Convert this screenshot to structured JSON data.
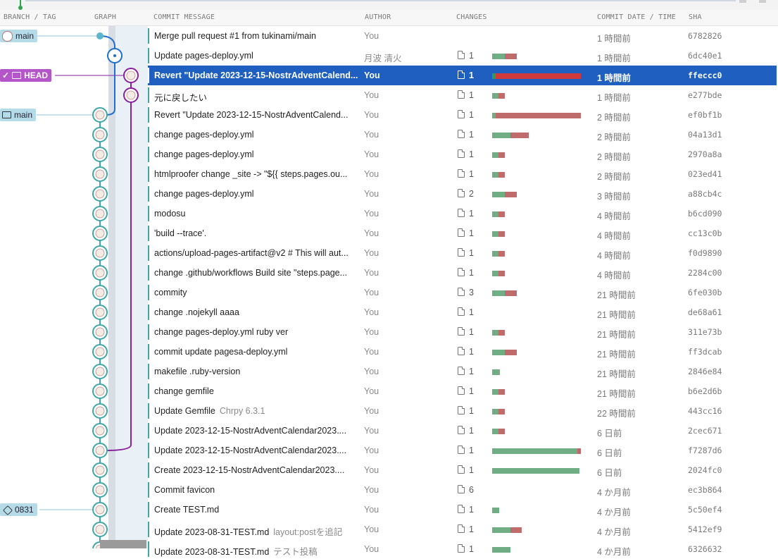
{
  "columns": {
    "branch_tag": "BRANCH / TAG",
    "graph": "GRAPH",
    "commit_message": "COMMIT MESSAGE",
    "author": "AUTHOR",
    "changes": "CHANGES",
    "commit_date": "COMMIT DATE / TIME",
    "sha": "SHA"
  },
  "labels": {
    "main_remote": "main",
    "head": "HEAD",
    "main_local": "main",
    "tag_0831": "0831"
  },
  "colors": {
    "selected_row": "#1f5fbf",
    "head_label": "#b455c9",
    "branch_label": "#b6dbe8",
    "lane_blue": "#1e6fd0",
    "lane_purple": "#8a1fa0",
    "lane_teal": "#3fa7a7",
    "additions": "#6fae85",
    "deletions": "#c06b6b"
  },
  "commits": [
    {
      "message": "Merge pull request #1 from tukinami/main",
      "tag": "",
      "author": "You",
      "changes": "",
      "add": 0,
      "del": 0,
      "date": "1 時間前",
      "sha": "6782826",
      "selected": false
    },
    {
      "message": "Update pages-deploy.yml",
      "tag": "",
      "author": "月波 清火",
      "changes": "1",
      "add": 18,
      "del": 17,
      "date": "1 時間前",
      "sha": "6dc40e1",
      "selected": false
    },
    {
      "message": "Revert \"Update 2023-12-15-NostrAdventCalend...",
      "tag": "",
      "author": "You",
      "changes": "1",
      "add": 5,
      "del": 121,
      "date": "1 時間前",
      "sha": "ffeccc0",
      "selected": true
    },
    {
      "message": "元に戻したい",
      "tag": "",
      "author": "You",
      "changes": "1",
      "add": 9,
      "del": 9,
      "date": "1 時間前",
      "sha": "e277bde",
      "selected": false
    },
    {
      "message": "Revert \"Update 2023-12-15-NostrAdventCalend...",
      "tag": "",
      "author": "You",
      "changes": "1",
      "add": 5,
      "del": 121,
      "date": "2 時間前",
      "sha": "ef0bf1b",
      "selected": false
    },
    {
      "message": "change pages-deploy.yml",
      "tag": "",
      "author": "You",
      "changes": "1",
      "add": 26,
      "del": 26,
      "date": "2 時間前",
      "sha": "04a13d1",
      "selected": false
    },
    {
      "message": "change pages-deploy.yml",
      "tag": "",
      "author": "You",
      "changes": "1",
      "add": 9,
      "del": 9,
      "date": "2 時間前",
      "sha": "2970a8a",
      "selected": false
    },
    {
      "message": "htmlproofer change _site -> \"${{ steps.pages.ou...",
      "tag": "",
      "author": "You",
      "changes": "1",
      "add": 9,
      "del": 9,
      "date": "2 時間前",
      "sha": "023ed41",
      "selected": false
    },
    {
      "message": "change pages-deploy.yml",
      "tag": "",
      "author": "You",
      "changes": "2",
      "add": 18,
      "del": 17,
      "date": "3 時間前",
      "sha": "a88cb4c",
      "selected": false
    },
    {
      "message": "modosu",
      "tag": "",
      "author": "You",
      "changes": "1",
      "add": 9,
      "del": 9,
      "date": "4 時間前",
      "sha": "b6cd090",
      "selected": false
    },
    {
      "message": "'build --trace'.",
      "tag": "",
      "author": "You",
      "changes": "1",
      "add": 9,
      "del": 9,
      "date": "4 時間前",
      "sha": "cc13c0b",
      "selected": false
    },
    {
      "message": "actions/upload-pages-artifact@v2 # This will aut...",
      "tag": "",
      "author": "You",
      "changes": "1",
      "add": 9,
      "del": 9,
      "date": "4 時間前",
      "sha": "f0d9890",
      "selected": false
    },
    {
      "message": "change .github/workflows Build site \"steps.page...",
      "tag": "",
      "author": "You",
      "changes": "1",
      "add": 9,
      "del": 9,
      "date": "4 時間前",
      "sha": "2284c00",
      "selected": false
    },
    {
      "message": "commity",
      "tag": "",
      "author": "You",
      "changes": "3",
      "add": 18,
      "del": 17,
      "date": "21 時間前",
      "sha": "6fe030b",
      "selected": false
    },
    {
      "message": "change .nojekyll aaaa",
      "tag": "",
      "author": "You",
      "changes": "1",
      "add": 0,
      "del": 0,
      "date": "21 時間前",
      "sha": "de68a61",
      "selected": false
    },
    {
      "message": "change pages-deploy.yml ruby ver",
      "tag": "",
      "author": "You",
      "changes": "1",
      "add": 9,
      "del": 9,
      "date": "21 時間前",
      "sha": "311e73b",
      "selected": false
    },
    {
      "message": "commit update pagesa-deploy.yml",
      "tag": "",
      "author": "You",
      "changes": "1",
      "add": 18,
      "del": 17,
      "date": "21 時間前",
      "sha": "ff3dcab",
      "selected": false
    },
    {
      "message": "makefile .ruby-version",
      "tag": "",
      "author": "You",
      "changes": "1",
      "add": 11,
      "del": 0,
      "date": "21 時間前",
      "sha": "2846e84",
      "selected": false
    },
    {
      "message": "change gemfile",
      "tag": "",
      "author": "You",
      "changes": "1",
      "add": 9,
      "del": 9,
      "date": "21 時間前",
      "sha": "b6e2d6b",
      "selected": false
    },
    {
      "message": "Update Gemfile",
      "tag": "Chrpy 6.3.1",
      "author": "You",
      "changes": "1",
      "add": 9,
      "del": 9,
      "date": "22 時間前",
      "sha": "443cc16",
      "selected": false
    },
    {
      "message": "Update 2023-12-15-NostrAdventCalendar2023....",
      "tag": "",
      "author": "You",
      "changes": "1",
      "add": 9,
      "del": 9,
      "date": "6 日前",
      "sha": "2cec671",
      "selected": false
    },
    {
      "message": "Update 2023-12-15-NostrAdventCalendar2023....",
      "tag": "",
      "author": "You",
      "changes": "1",
      "add": 121,
      "del": 5,
      "date": "6 日前",
      "sha": "f7287d6",
      "selected": false
    },
    {
      "message": "Create 2023-12-15-NostrAdventCalendar2023....",
      "tag": "",
      "author": "You",
      "changes": "1",
      "add": 124,
      "del": 0,
      "date": "6 日前",
      "sha": "2024fc0",
      "selected": false
    },
    {
      "message": "Commit favicon",
      "tag": "",
      "author": "You",
      "changes": "6",
      "add": 0,
      "del": 0,
      "date": "4 か月前",
      "sha": "ec3b864",
      "selected": false
    },
    {
      "message": "Create TEST.md",
      "tag": "",
      "author": "You",
      "changes": "1",
      "add": 10,
      "del": 0,
      "date": "4 か月前",
      "sha": "5c50ef4",
      "selected": false
    },
    {
      "message": "Update 2023-08-31-TEST.md",
      "tag": "layout:postを追記",
      "author": "You",
      "changes": "1",
      "add": 26,
      "del": 16,
      "date": "4 か月前",
      "sha": "5412ef9",
      "selected": false
    },
    {
      "message": "Update 2023-08-31-TEST.md",
      "tag": "テスト投稿",
      "author": "You",
      "changes": "1",
      "add": 26,
      "del": 0,
      "date": "4 か月前",
      "sha": "6326632",
      "selected": false
    }
  ]
}
